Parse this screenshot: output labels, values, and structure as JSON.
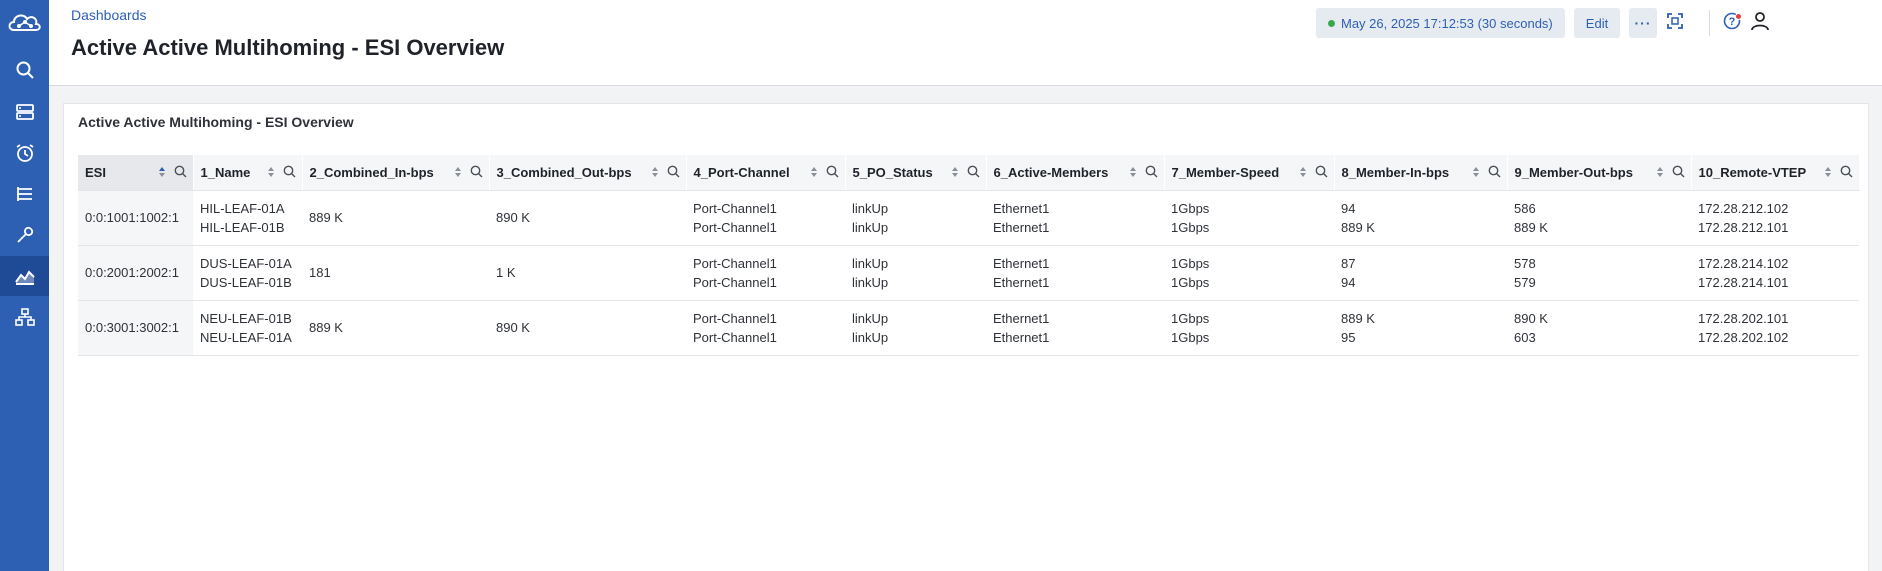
{
  "header": {
    "breadcrumb": "Dashboards",
    "title": "Active Active Multihoming - ESI Overview",
    "time_range": "May 26, 2025 17:12:53 (30 seconds)",
    "edit_label": "Edit",
    "more_label": "···"
  },
  "sidebar": {
    "items": [
      {
        "name": "search-icon"
      },
      {
        "name": "servers-icon"
      },
      {
        "name": "alarm-icon"
      },
      {
        "name": "tasks-icon"
      },
      {
        "name": "wrench-icon"
      },
      {
        "name": "dashboards-icon",
        "active": true
      },
      {
        "name": "topology-icon"
      }
    ]
  },
  "panel": {
    "title": "Active Active Multihoming - ESI Overview"
  },
  "table": {
    "columns": [
      "ESI",
      "1_Name",
      "2_Combined_In-bps",
      "3_Combined_Out-bps",
      "4_Port-Channel",
      "5_PO_Status",
      "6_Active-Members",
      "7_Member-Speed",
      "8_Member-In-bps",
      "9_Member-Out-bps",
      "10_Remote-VTEP"
    ],
    "rows": [
      {
        "esi": "0:0:1001:1002:1",
        "name": [
          "HIL-LEAF-01A",
          "HIL-LEAF-01B"
        ],
        "combined_in": "889 K",
        "combined_out": "890 K",
        "port_channel": [
          "Port-Channel1",
          "Port-Channel1"
        ],
        "po_status": [
          "linkUp",
          "linkUp"
        ],
        "active_members": [
          "Ethernet1",
          "Ethernet1"
        ],
        "member_speed": [
          "1Gbps",
          "1Gbps"
        ],
        "member_in": [
          "94",
          "889 K"
        ],
        "member_out": [
          "586",
          "889 K"
        ],
        "remote_vtep": [
          "172.28.212.102",
          "172.28.212.101"
        ]
      },
      {
        "esi": "0:0:2001:2002:1",
        "name": [
          "DUS-LEAF-01A",
          "DUS-LEAF-01B"
        ],
        "combined_in": "181",
        "combined_out": "1 K",
        "port_channel": [
          "Port-Channel1",
          "Port-Channel1"
        ],
        "po_status": [
          "linkUp",
          "linkUp"
        ],
        "active_members": [
          "Ethernet1",
          "Ethernet1"
        ],
        "member_speed": [
          "1Gbps",
          "1Gbps"
        ],
        "member_in": [
          "87",
          "94"
        ],
        "member_out": [
          "578",
          "579"
        ],
        "remote_vtep": [
          "172.28.214.102",
          "172.28.214.101"
        ]
      },
      {
        "esi": "0:0:3001:3002:1",
        "name": [
          "NEU-LEAF-01B",
          "NEU-LEAF-01A"
        ],
        "combined_in": "889 K",
        "combined_out": "890 K",
        "port_channel": [
          "Port-Channel1",
          "Port-Channel1"
        ],
        "po_status": [
          "linkUp",
          "linkUp"
        ],
        "active_members": [
          "Ethernet1",
          "Ethernet1"
        ],
        "member_speed": [
          "1Gbps",
          "1Gbps"
        ],
        "member_in": [
          "889 K",
          "95"
        ],
        "member_out": [
          "890 K",
          "603"
        ],
        "remote_vtep": [
          "172.28.202.101",
          "172.28.202.102"
        ]
      }
    ]
  },
  "colors": {
    "sidebar": "#2d5fb3",
    "sidebar_active": "#1f4a96",
    "accent": "#2d5fb3",
    "status_ok": "#3aa84a",
    "notification": "#e0413a"
  }
}
